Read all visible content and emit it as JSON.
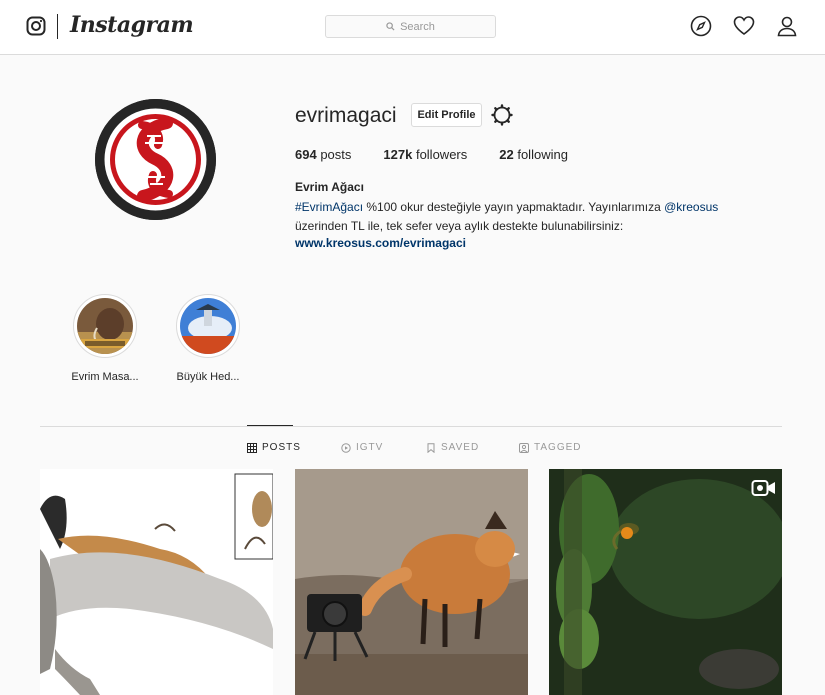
{
  "nav": {
    "brand": "Instagram",
    "search_placeholder": "Search",
    "icons": [
      "compass-icon",
      "heart-icon",
      "person-icon"
    ]
  },
  "profile": {
    "username": "evrimagaci",
    "edit_label": "Edit Profile",
    "stats": {
      "posts_count": "694",
      "posts_label": "posts",
      "followers_count": "127k",
      "followers_label": "followers",
      "following_count": "22",
      "following_label": "following"
    },
    "full_name": "Evrim Ağacı",
    "bio_hashtag": "#EvrimAğacı",
    "bio_text_1": " %100 okur desteğiyle yayın yapmaktadır. Yayınlarımıza ",
    "bio_mention": "@kreosus",
    "bio_text_2": " üzerinden TL ile, tek sefer veya aylık destekte bulunabilirsiniz:",
    "website": "www.kreosus.com/evrimagaci"
  },
  "highlights": [
    {
      "label": "Evrim Masa..."
    },
    {
      "label": "Büyük Hed..."
    }
  ],
  "tabs": [
    {
      "label": "POSTS",
      "active": true
    },
    {
      "label": "IGTV",
      "active": false
    },
    {
      "label": "SAVED",
      "active": false
    },
    {
      "label": "TAGGED",
      "active": false
    }
  ],
  "colors": {
    "accent_red": "#c8161d",
    "link_blue": "#003569",
    "border": "#dbdbdb"
  }
}
